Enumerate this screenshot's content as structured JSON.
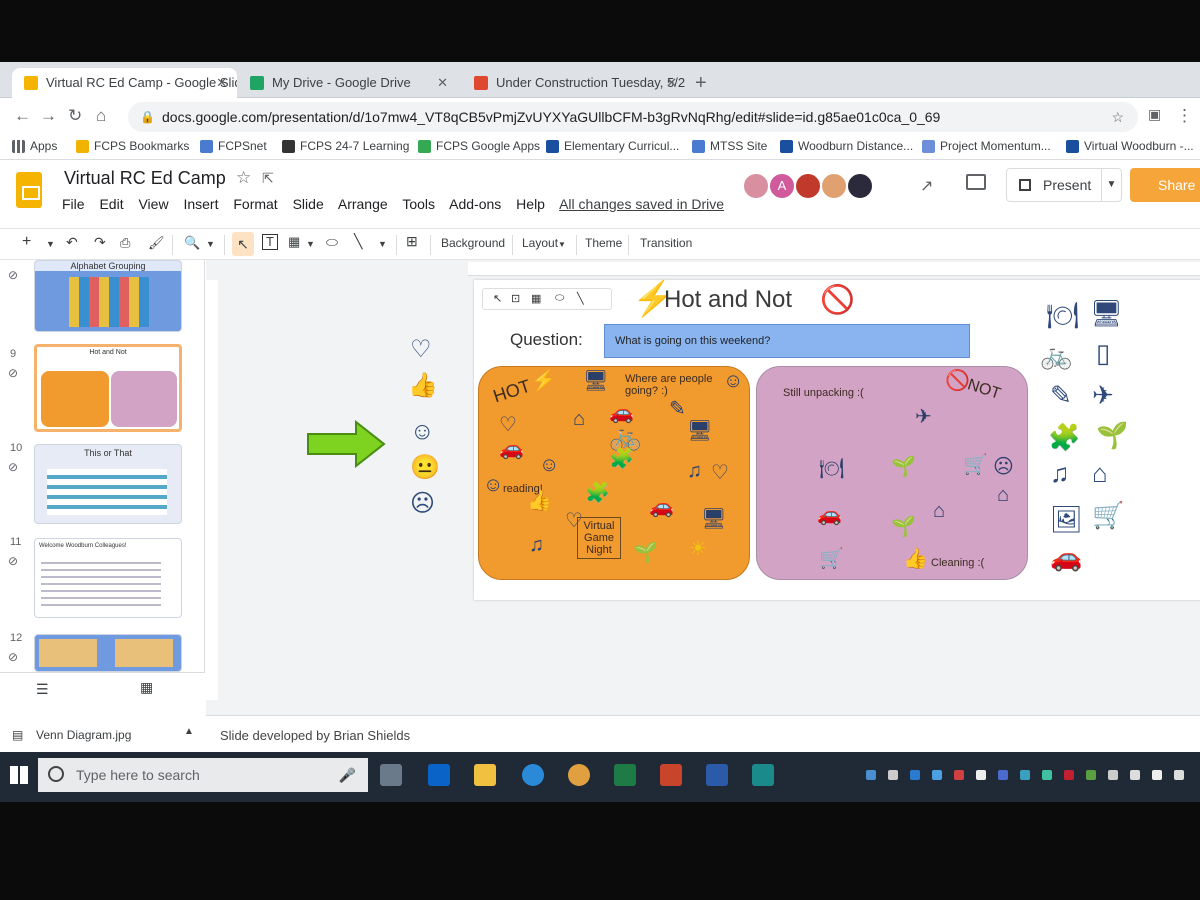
{
  "browser": {
    "tabs": [
      {
        "title": "Virtual RC Ed Camp - Google Slid",
        "color": "#f4b400",
        "active": true
      },
      {
        "title": "My Drive - Google Drive",
        "color": "#1fa463",
        "active": false
      },
      {
        "title": "Under Construction Tuesday, 5/2",
        "color": "#e0472f",
        "active": false
      }
    ],
    "new_tab": "+",
    "url": "docs.google.com/presentation/d/1o7mw4_VT8qCB5vPmjZvUYXYaGUllbCFM-b3gRvNqRhg/edit#slide=id.g85ae01c0ca_0_69",
    "bookmarks": [
      {
        "label": "Apps",
        "color": "#5f6368"
      },
      {
        "label": "FCPS Bookmarks",
        "color": "#f0b400"
      },
      {
        "label": "FCPSnet",
        "color": "#4a7bd0"
      },
      {
        "label": "FCPS 24-7 Learning",
        "color": "#333333"
      },
      {
        "label": "FCPS Google Apps",
        "color": "#34a853"
      },
      {
        "label": "Elementary Curricul...",
        "color": "#1a4fa0"
      },
      {
        "label": "MTSS Site",
        "color": "#4a7bd0"
      },
      {
        "label": "Woodburn Distance...",
        "color": "#1a4fa0"
      },
      {
        "label": "Project Momentum...",
        "color": "#6d8ed8"
      },
      {
        "label": "Virtual Woodburn -...",
        "color": "#1a4fa0"
      }
    ]
  },
  "docs": {
    "title": "Virtual RC Ed Camp",
    "menu": [
      "File",
      "Edit",
      "View",
      "Insert",
      "Format",
      "Slide",
      "Arrange",
      "Tools",
      "Add-ons",
      "Help"
    ],
    "save_status": "All changes saved in Drive",
    "collaborator_initial": "A",
    "more_collaborators": "+2",
    "present_label": "Present",
    "share_label": "Share",
    "toolbar": {
      "background": "Background",
      "layout": "Layout",
      "theme": "Theme",
      "transition": "Transition"
    }
  },
  "filmstrip": [
    {
      "num": "",
      "label": "Alphabet Grouping"
    },
    {
      "num": "9",
      "label": "Hot and Not"
    },
    {
      "num": "10",
      "label": "This or That"
    },
    {
      "num": "11",
      "label": "Welcome Woodburn Colleagues!"
    },
    {
      "num": "12",
      "label": ""
    }
  ],
  "slide": {
    "title": "Hot and Not",
    "question_label": "Question:",
    "question_text": "What is going on this weekend?",
    "hot_label": "HOT",
    "not_label": "NOT",
    "hot_notes": [
      "Where are people going? :)",
      "reading!",
      "Virtual Game Night"
    ],
    "not_notes": [
      "Still unpacking :(",
      "Cleaning :("
    ],
    "colors": {
      "hot": "#f19a2e",
      "not": "#d3a3c6",
      "question": "#8ab4f0",
      "arrow": "#7ed321"
    }
  },
  "notes": "Slide developed by Brian Shields",
  "download": {
    "filename": "Venn Diagram.jpg"
  },
  "taskbar": {
    "search_placeholder": "Type here to search"
  }
}
